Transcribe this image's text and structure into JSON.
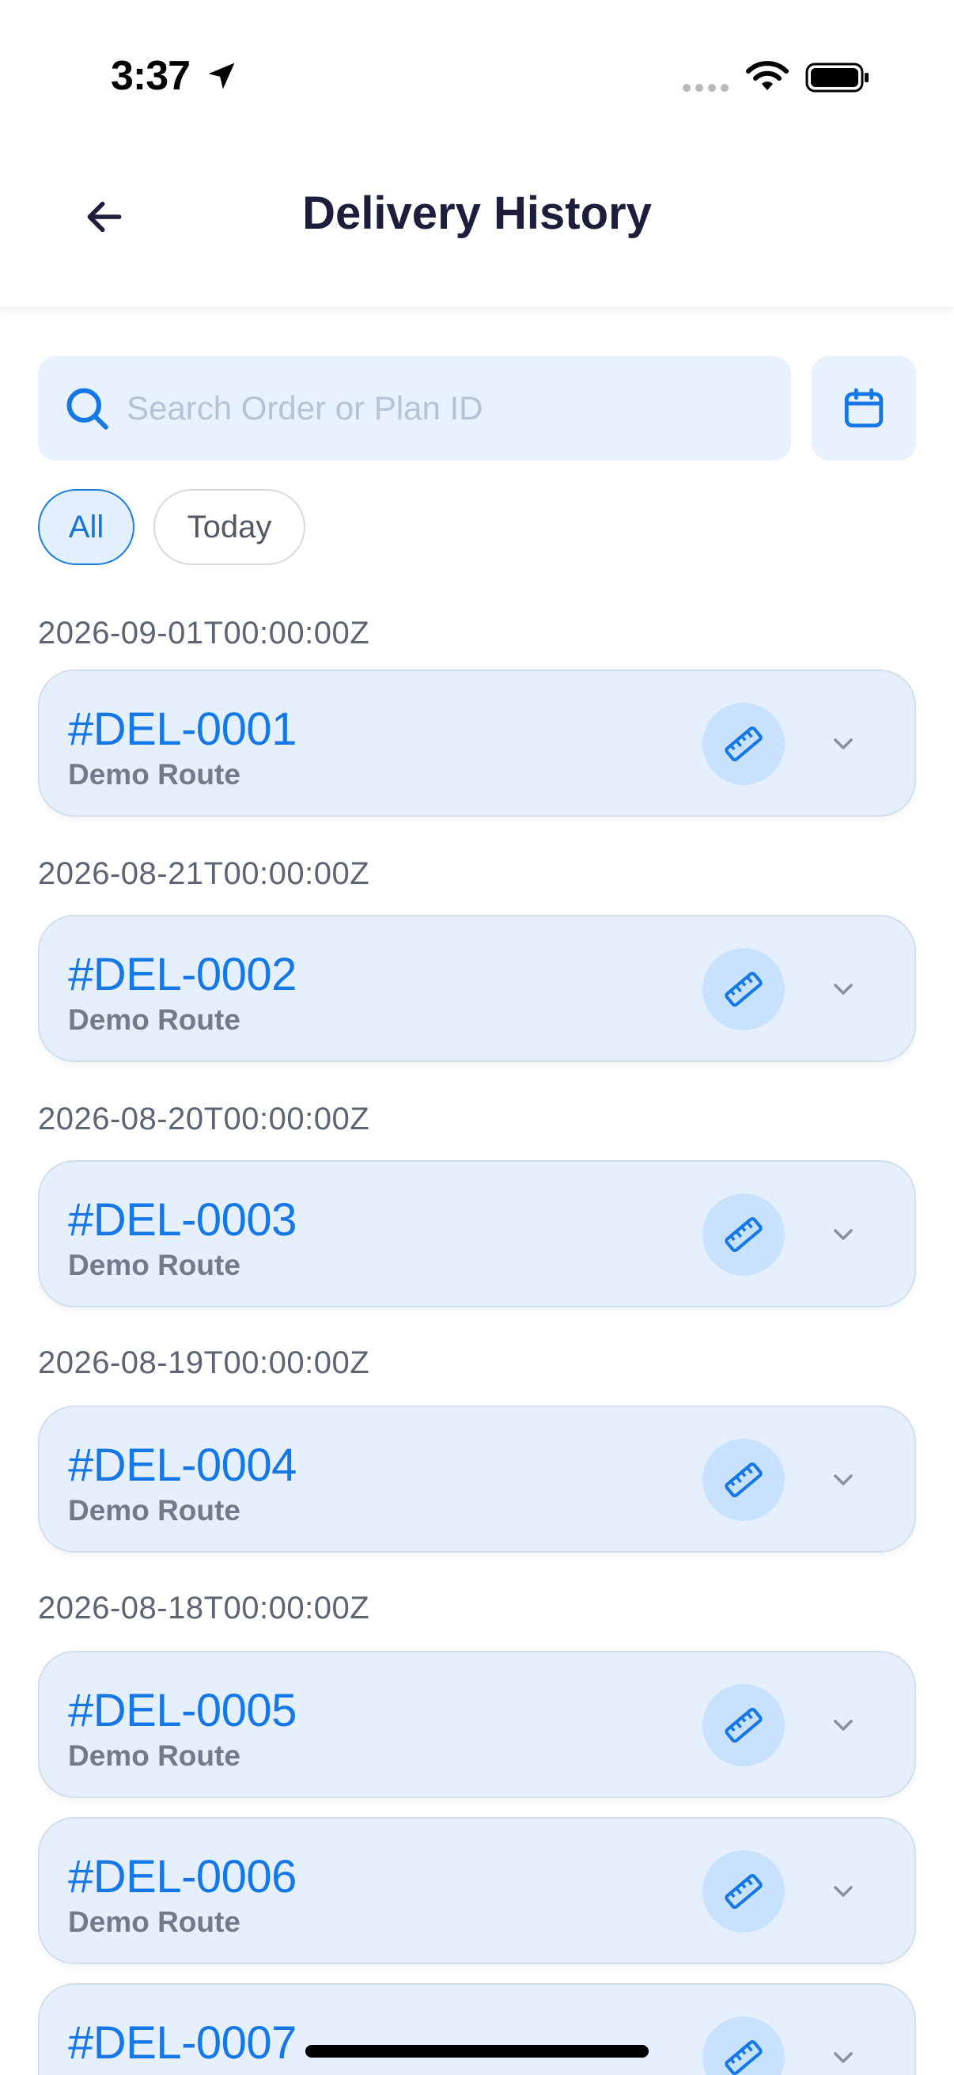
{
  "status_bar": {
    "time": "3:37"
  },
  "header": {
    "title": "Delivery History"
  },
  "search": {
    "placeholder": "Search Order or Plan ID",
    "value": ""
  },
  "filters": {
    "all_label": "All",
    "today_label": "Today"
  },
  "groups": [
    {
      "date": "2026-09-01T00:00:00Z",
      "items": [
        {
          "id": "#DEL-0001",
          "route": "Demo Route"
        }
      ]
    },
    {
      "date": "2026-08-21T00:00:00Z",
      "items": [
        {
          "id": "#DEL-0002",
          "route": "Demo Route"
        }
      ]
    },
    {
      "date": "2026-08-20T00:00:00Z",
      "items": [
        {
          "id": "#DEL-0003",
          "route": "Demo Route"
        }
      ]
    },
    {
      "date": "2026-08-19T00:00:00Z",
      "items": [
        {
          "id": "#DEL-0004",
          "route": "Demo Route"
        }
      ]
    },
    {
      "date": "2026-08-18T00:00:00Z",
      "items": [
        {
          "id": "#DEL-0005",
          "route": "Demo Route"
        },
        {
          "id": "#DEL-0006",
          "route": "Demo Route"
        },
        {
          "id": "#DEL-0007",
          "route": ""
        }
      ]
    }
  ],
  "colors": {
    "accent": "#1578e6",
    "card_bg": "#e6f0fd",
    "search_bg": "#e7f2fe"
  },
  "icons": {
    "back": "arrow-left-icon",
    "search": "search-icon",
    "calendar": "calendar-icon",
    "ruler": "ruler-icon",
    "chevron": "chevron-down-icon"
  }
}
